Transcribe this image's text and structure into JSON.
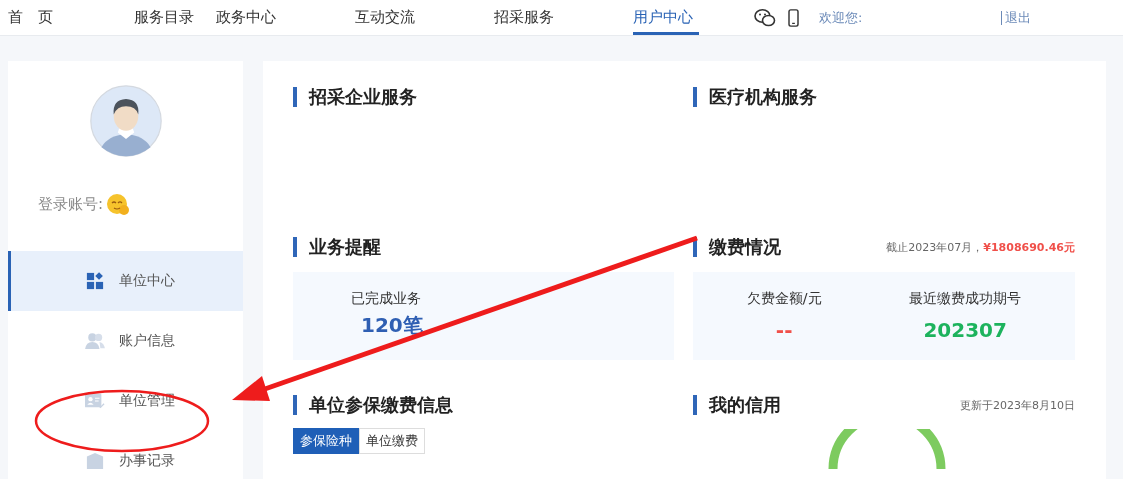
{
  "nav": {
    "items": [
      {
        "label": "首　页",
        "selected": false
      },
      {
        "label": "服务目录",
        "selected": false
      },
      {
        "label": "政务中心",
        "selected": false
      },
      {
        "label": "互动交流",
        "selected": false
      },
      {
        "label": "招采服务",
        "selected": false
      },
      {
        "label": "用户中心",
        "selected": true
      }
    ],
    "welcome": "欢迎您:",
    "logout": "退出"
  },
  "sidebar": {
    "account_label": "登录账号:",
    "menu": [
      {
        "label": "单位中心",
        "selected": true,
        "kind": "grid"
      },
      {
        "label": "账户信息",
        "selected": false,
        "kind": "users"
      },
      {
        "label": "单位管理",
        "selected": false,
        "kind": "card"
      },
      {
        "label": "办事记录",
        "selected": false,
        "kind": "shield"
      }
    ]
  },
  "sections": {
    "procurement": {
      "title": "招采企业服务"
    },
    "medical": {
      "title": "医疗机构服务"
    },
    "reminders": {
      "title": "业务提醒",
      "stat_label": "已完成业务",
      "stat_value": "120笔"
    },
    "payments": {
      "title": "缴费情况",
      "note": "截止2023年07月，",
      "amount": "¥1808690.46元",
      "stats": [
        {
          "label": "欠费金额/元",
          "value": "--",
          "color": "#f0504a"
        },
        {
          "label": "最近缴费成功期号",
          "value": "202307",
          "color": "#1db35d"
        }
      ]
    },
    "insurance": {
      "title": "单位参保缴费信息",
      "tabs": [
        {
          "label": "参保险种",
          "selected": true
        },
        {
          "label": "单位缴费",
          "selected": false
        }
      ]
    },
    "credit": {
      "title": "我的信用",
      "updated": "更新于2023年8月10日"
    }
  }
}
